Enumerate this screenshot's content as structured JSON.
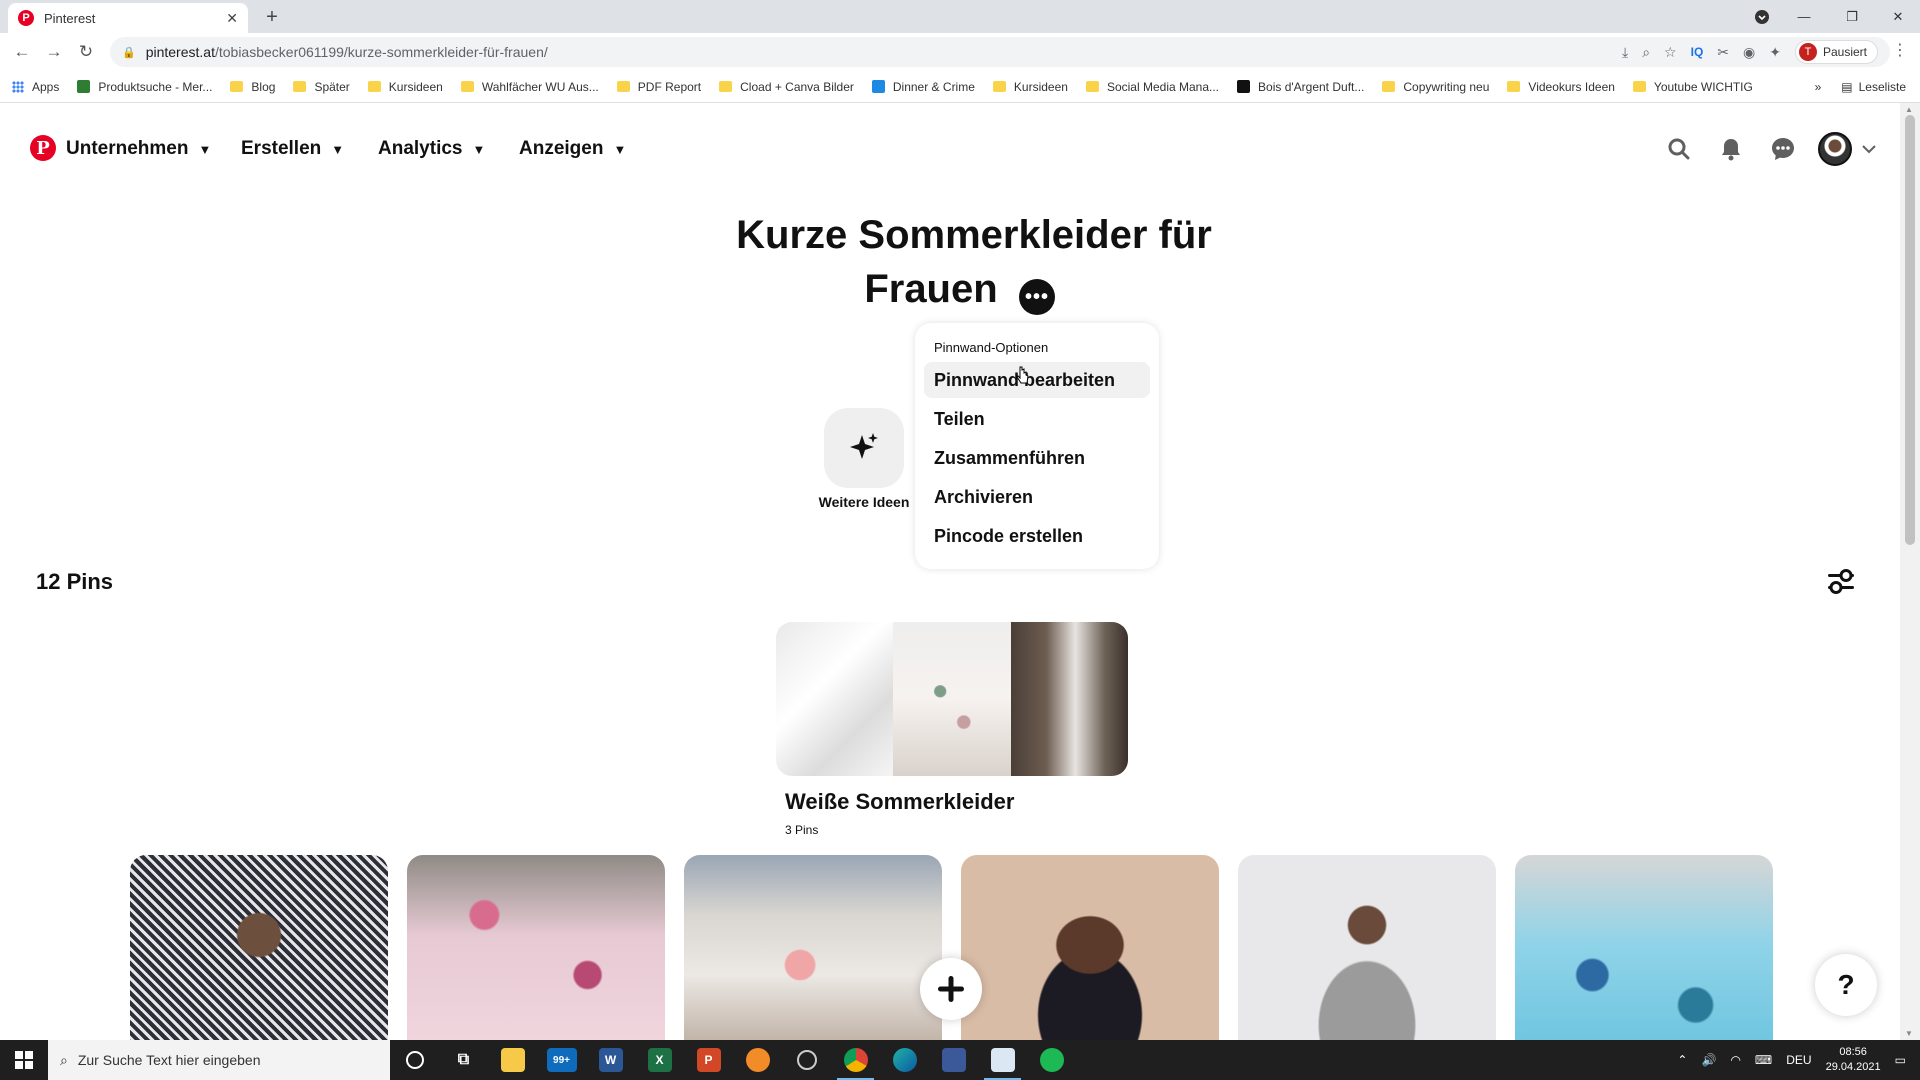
{
  "browser": {
    "tab_title": "Pinterest",
    "url_domain": "pinterest.at",
    "url_path": "/tobiasbecker061199/kurze-sommerkleider-für-frauen/",
    "profile_label": "Pausiert",
    "profile_initial": "T",
    "bookmarks": [
      {
        "label": "Apps",
        "kind": "grid"
      },
      {
        "label": "Produktsuche - Mer...",
        "kind": "sq",
        "color": "#2e7d32"
      },
      {
        "label": "Blog",
        "kind": "folder"
      },
      {
        "label": "Später",
        "kind": "folder"
      },
      {
        "label": "Kursideen",
        "kind": "folder"
      },
      {
        "label": "Wahlfächer WU Aus...",
        "kind": "folder"
      },
      {
        "label": "PDF Report",
        "kind": "folder"
      },
      {
        "label": "Cload + Canva Bilder",
        "kind": "folder"
      },
      {
        "label": "Dinner & Crime",
        "kind": "sq",
        "color": "#1e88e5"
      },
      {
        "label": "Kursideen",
        "kind": "folder"
      },
      {
        "label": "Social Media Mana...",
        "kind": "folder"
      },
      {
        "label": "Bois d'Argent Duft...",
        "kind": "sq",
        "color": "#111111"
      },
      {
        "label": "Copywriting neu",
        "kind": "folder"
      },
      {
        "label": "Videokurs Ideen",
        "kind": "folder"
      },
      {
        "label": "Youtube WICHTIG",
        "kind": "folder"
      }
    ],
    "bookmarks_more": "»",
    "reading_list": "Leseliste"
  },
  "header": {
    "nav": [
      "Unternehmen",
      "Erstellen",
      "Analytics",
      "Anzeigen"
    ]
  },
  "board": {
    "title_line1": "Kurze Sommerkleider für",
    "title_line2": "Frauen",
    "more_ideas_label": "Weitere Ideen",
    "pins_count": "12 Pins"
  },
  "dropdown": {
    "heading": "Pinnwand-Optionen",
    "items": [
      "Pinnwand bearbeiten",
      "Teilen",
      "Zusammenführen",
      "Archivieren",
      "Pincode erstellen"
    ]
  },
  "section": {
    "title": "Weiße Sommerkleider",
    "count": "3 Pins"
  },
  "help": {
    "label": "?"
  },
  "taskbar": {
    "search_placeholder": "Zur Suche Text hier eingeben",
    "mail_badge": "99+",
    "language": "DEU",
    "time": "08:56",
    "date": "29.04.2021"
  },
  "colors": {
    "pinterest_red": "#e60023",
    "text": "#111111",
    "hover_bg": "#f1f1f1"
  }
}
